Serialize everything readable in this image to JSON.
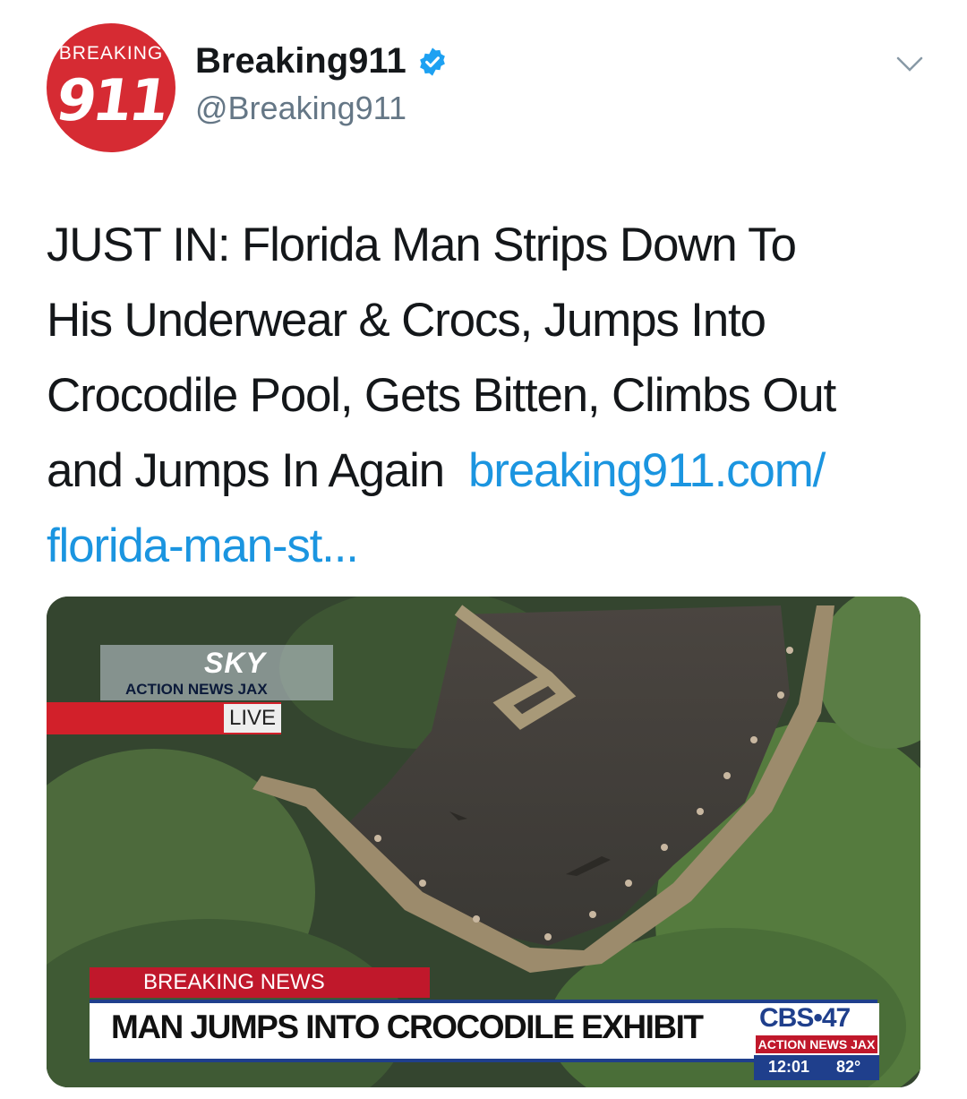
{
  "avatar": {
    "tag": "BREAKING",
    "number": "911"
  },
  "author": {
    "name": "Breaking911",
    "handle": "@Breaking911"
  },
  "tweet": {
    "lines": [
      "JUST IN: Florida Man Strips Down To",
      "His Underwear & Crocs, Jumps Into",
      "Crocodile Pool, Gets Bitten, Climbs Out",
      "and Jumps In Again"
    ],
    "link_part1": "breaking911.com/",
    "link_part2": "florida-man-st..."
  },
  "media": {
    "sky_logo": "SKY",
    "sky_sub": "ACTION NEWS JAX",
    "live": "LIVE",
    "breaking_label": "BREAKING NEWS",
    "headline": "MAN JUMPS INTO CROCODILE EXHIBIT",
    "station": "CBS•47",
    "station_sub": "ACTION NEWS JAX",
    "time": "12:01",
    "temp": "82°"
  },
  "icons": {
    "verified": "verified-badge-icon",
    "menu": "chevron-down-icon"
  },
  "colors": {
    "link": "#1b95e0",
    "brand_red": "#d62b33",
    "verified": "#1da1f2"
  }
}
